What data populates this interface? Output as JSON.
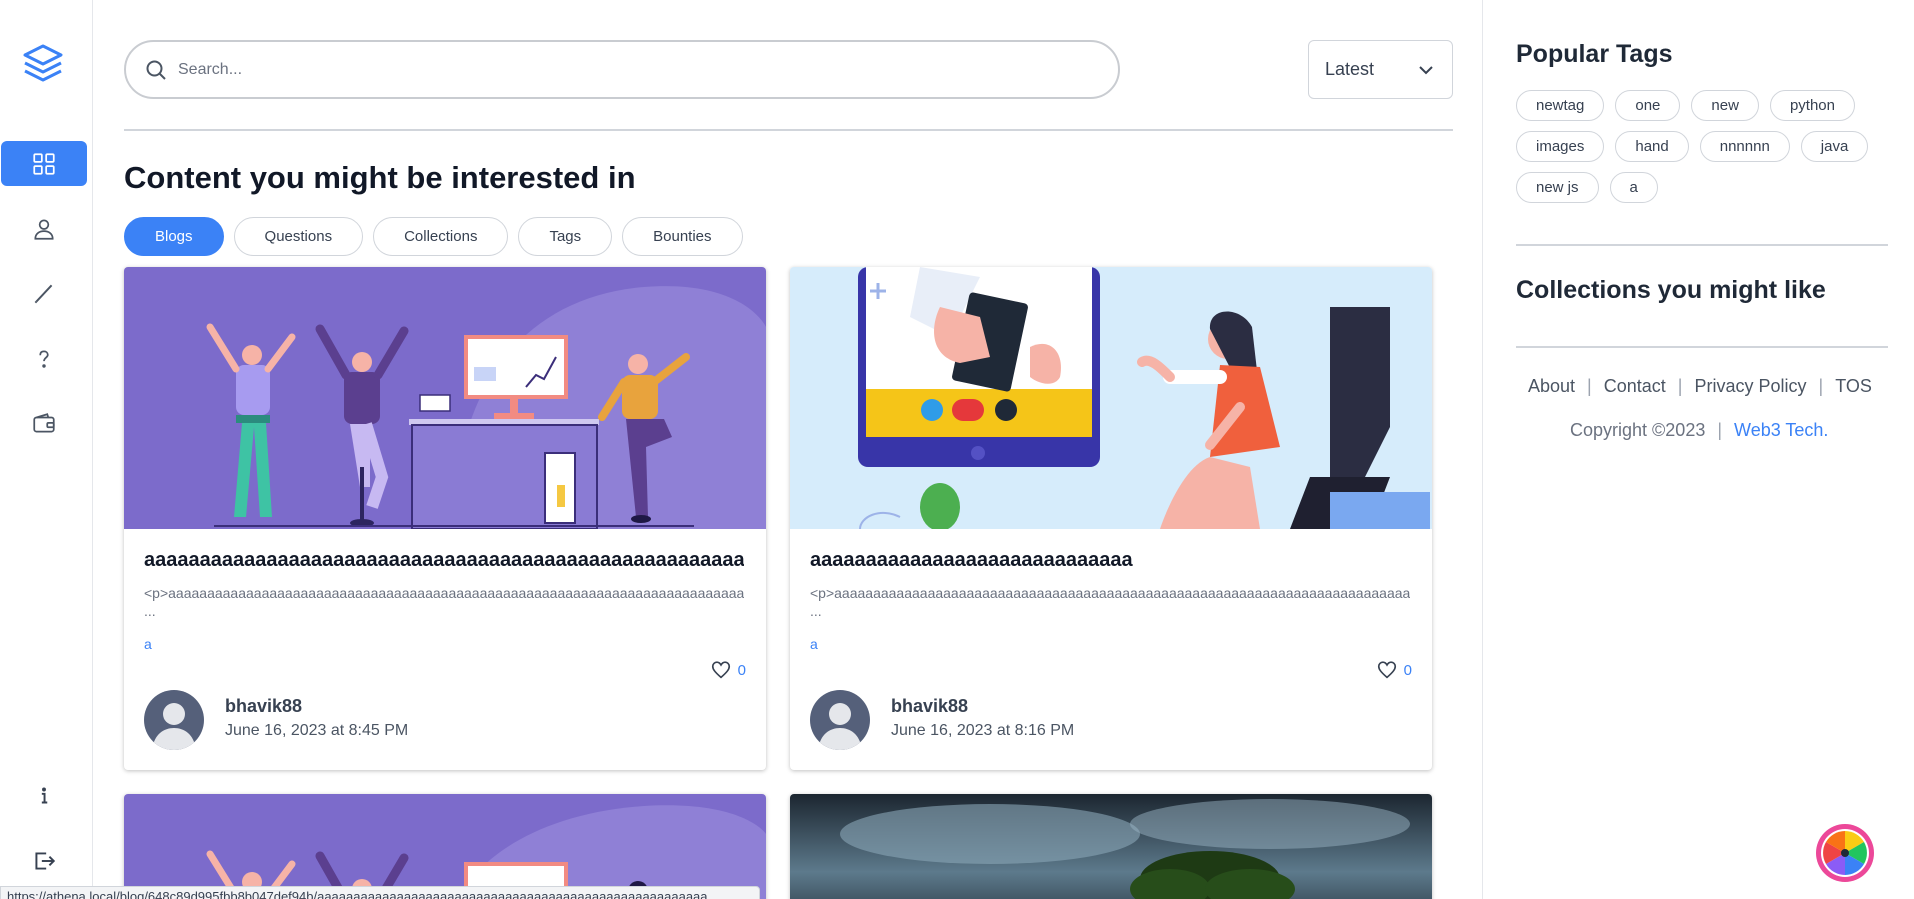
{
  "sidebar": {
    "logo_icon": "layers-icon",
    "items": [
      {
        "name": "home",
        "icon": "grid-icon",
        "active": true
      },
      {
        "name": "profile",
        "icon": "user-icon",
        "active": false
      },
      {
        "name": "write",
        "icon": "pen-icon",
        "active": false
      },
      {
        "name": "questions",
        "icon": "question-icon",
        "active": false
      },
      {
        "name": "wallet",
        "icon": "wallet-icon",
        "active": false
      }
    ],
    "info_icon": "info-icon",
    "logout_icon": "logout-icon"
  },
  "search": {
    "placeholder": "Search...",
    "value": ""
  },
  "sort": {
    "selected": "Latest"
  },
  "main": {
    "heading": "Content you might be interested in",
    "tabs": [
      "Blogs",
      "Questions",
      "Collections",
      "Tags",
      "Bounties"
    ],
    "active_tab": "Blogs",
    "cards": [
      {
        "title": "aaaaaaaaaaaaaaaaaaaaaaaaaaaaaaaaaaaaaaaaaaaaaaaaaaaaaaaaaaaaaaaaaaaaaaaaaa",
        "excerpt": "<p>aaaaaaaaaaaaaaaaaaaaaaaaaaaaaaaaaaaaaaaaaaaaaaaaaaaaaaaaaaaaaaaaaaaaaaaaaaaaaaaaaaaaaaaa",
        "ellipsis": "...",
        "tag": "a",
        "likes": "0",
        "author": "bhavik88",
        "date": "June 16, 2023 at 8:45 PM"
      },
      {
        "title": "aaaaaaaaaaaaaaaaaaaaaaaaaaaaa",
        "excerpt": "<p>aaaaaaaaaaaaaaaaaaaaaaaaaaaaaaaaaaaaaaaaaaaaaaaaaaaaaaaaaaaaaaaaaaaaaaaaaaaaaaaa",
        "ellipsis": "...",
        "tag": "a",
        "likes": "0",
        "author": "bhavik88",
        "date": "June 16, 2023 at 8:16 PM"
      }
    ]
  },
  "status_url": "https://athena.local/blog/648c89d995fbb8b047def94b/aaaaaaaaaaaaaaaaaaaaaaaaaaaaaaaaaaaaaaaaaaaaaaaaaaaaaa",
  "right": {
    "popular_tags_title": "Popular Tags",
    "tags": [
      "newtag",
      "one",
      "new",
      "python",
      "images",
      "hand",
      "nnnnnn",
      "java",
      "new js",
      "a"
    ],
    "collections_title": "Collections you might like",
    "footer_links": [
      "About",
      "Contact",
      "Privacy Policy",
      "TOS"
    ],
    "copyright": "Copyright ©2023",
    "brand": "Web3 Tech."
  },
  "colors": {
    "accent": "#3b82f6",
    "border": "#d1d5db"
  }
}
